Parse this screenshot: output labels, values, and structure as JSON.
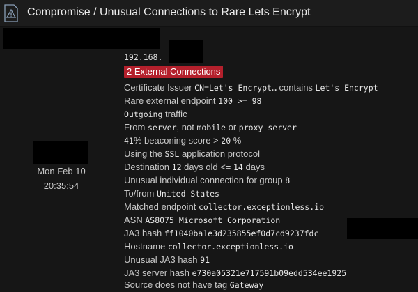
{
  "header": {
    "title": "Compromise / Unusual Connections to Rare Lets Encrypt",
    "icon": "alert-triangle-icon"
  },
  "left": {
    "date": "Mon Feb 10",
    "time": "20:35:54"
  },
  "ip_prefix": "192.168.",
  "badge": {
    "label": "2 External Connections",
    "color": "#b4202c"
  },
  "details": {
    "cert_label": "Certificate Issuer",
    "cert_value": "CN=Let's Encrypt…",
    "cert_contains": "contains",
    "cert_match": "Let's Encrypt",
    "rare_label": "Rare external endpoint",
    "rare_value": "100 >= 98",
    "outgoing_value": "Outgoing",
    "outgoing_label": "traffic",
    "from_label": "From",
    "from_value": "server",
    "from_not": ", not",
    "from_mobile": "mobile",
    "from_or": "or",
    "from_proxy": "proxy server",
    "beacon_value": "41",
    "beacon_label": "% beaconing score >",
    "beacon_threshold": "20",
    "beacon_pct": "%",
    "ssl_label_pre": "Using the",
    "ssl_value": "SSL",
    "ssl_label_post": "application protocol",
    "dest_label": "Destination",
    "dest_value": "12",
    "dest_label_mid": "days old <=",
    "dest_value_2": "14",
    "dest_label_post": "days",
    "unusual_label": "Unusual individual connection for group",
    "unusual_value": "8",
    "tofrom_label": "To/from",
    "tofrom_value": "United States",
    "matched_label": "Matched endpoint",
    "matched_value": "collector.exceptionless.io",
    "asn_label": "ASN",
    "asn_value": "AS8075 Microsoft Corporation",
    "ja3_label": "JA3 hash",
    "ja3_value": "ff1040ba1e3d235855ef0d7cd9237fdc",
    "hostname_label": "Hostname",
    "hostname_value": "collector.exceptionless.io",
    "unusual_ja3_label": "Unusual JA3 hash",
    "unusual_ja3_value": "91",
    "ja3s_label": "JA3 server hash",
    "ja3s_value": "e730a05321e717591b09edd534ee1925",
    "tag_label": "Source does not have tag",
    "tag_value": "Gateway"
  }
}
